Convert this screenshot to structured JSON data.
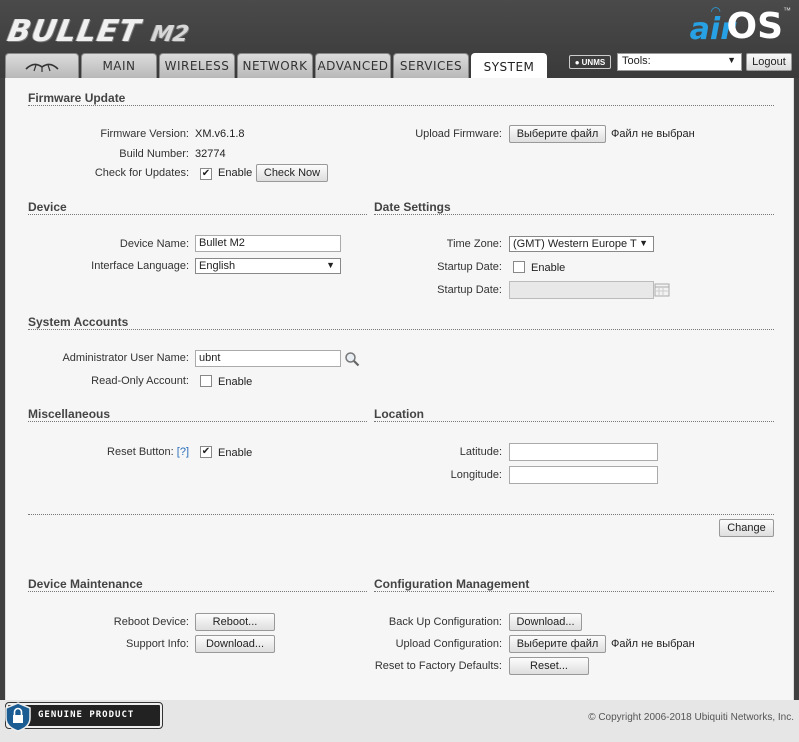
{
  "header": {
    "product_name": "BULLET",
    "product_model": "M2",
    "brand_air": "air",
    "brand_os": "OS",
    "brand_tm": "™"
  },
  "tabs": [
    {
      "label": "MAIN"
    },
    {
      "label": "WIRELESS"
    },
    {
      "label": "NETWORK"
    },
    {
      "label": "ADVANCED"
    },
    {
      "label": "SERVICES"
    },
    {
      "label": "SYSTEM",
      "active": true
    }
  ],
  "toolbar": {
    "unms_label": "UNMS",
    "tools_value": "Tools:",
    "logout_label": "Logout"
  },
  "firmware": {
    "title": "Firmware Update",
    "version_label": "Firmware Version:",
    "version_value": "XM.v6.1.8",
    "build_label": "Build Number:",
    "build_value": "32774",
    "check_label": "Check for Updates:",
    "check_enable": "Enable",
    "check_now": "Check Now",
    "upload_label": "Upload Firmware:",
    "choose_file": "Выберите файл",
    "no_file": "Файл не выбран"
  },
  "device": {
    "title": "Device",
    "name_label": "Device Name:",
    "name_value": "Bullet M2",
    "lang_label": "Interface Language:",
    "lang_value": "English"
  },
  "date_settings": {
    "title": "Date Settings",
    "tz_label": "Time Zone:",
    "tz_value": "(GMT) Western Europe T",
    "startup_label": "Startup Date:",
    "startup_enable": "Enable",
    "startup_date_label": "Startup Date:",
    "startup_date_value": ""
  },
  "accounts": {
    "title": "System Accounts",
    "admin_label": "Administrator User Name:",
    "admin_value": "ubnt",
    "readonly_label": "Read-Only Account:",
    "readonly_enable": "Enable"
  },
  "misc": {
    "title": "Miscellaneous",
    "reset_label": "Reset Button:",
    "reset_help": "[?]",
    "reset_enable": "Enable"
  },
  "location": {
    "title": "Location",
    "lat_label": "Latitude:",
    "lat_value": "",
    "lon_label": "Longitude:",
    "lon_value": ""
  },
  "change_label": "Change",
  "maintenance": {
    "title": "Device Maintenance",
    "reboot_label": "Reboot Device:",
    "reboot_btn": "Reboot...",
    "support_label": "Support Info:",
    "support_btn": "Download..."
  },
  "config": {
    "title": "Configuration Management",
    "backup_label": "Back Up Configuration:",
    "backup_btn": "Download...",
    "upload_label": "Upload Configuration:",
    "choose_file": "Выберите файл",
    "no_file": "Файл не выбран",
    "reset_label": "Reset to Factory Defaults:",
    "reset_btn": "Reset..."
  },
  "footer": {
    "genuine_text": "GENUINE  PRODUCT",
    "copyright": "© Copyright 2006-2018 Ubiquiti Networks, Inc."
  },
  "colors": {
    "header_bg": "#404040",
    "brand_blue": "#27a1e3",
    "panel_bg": "#f6f6f6"
  }
}
